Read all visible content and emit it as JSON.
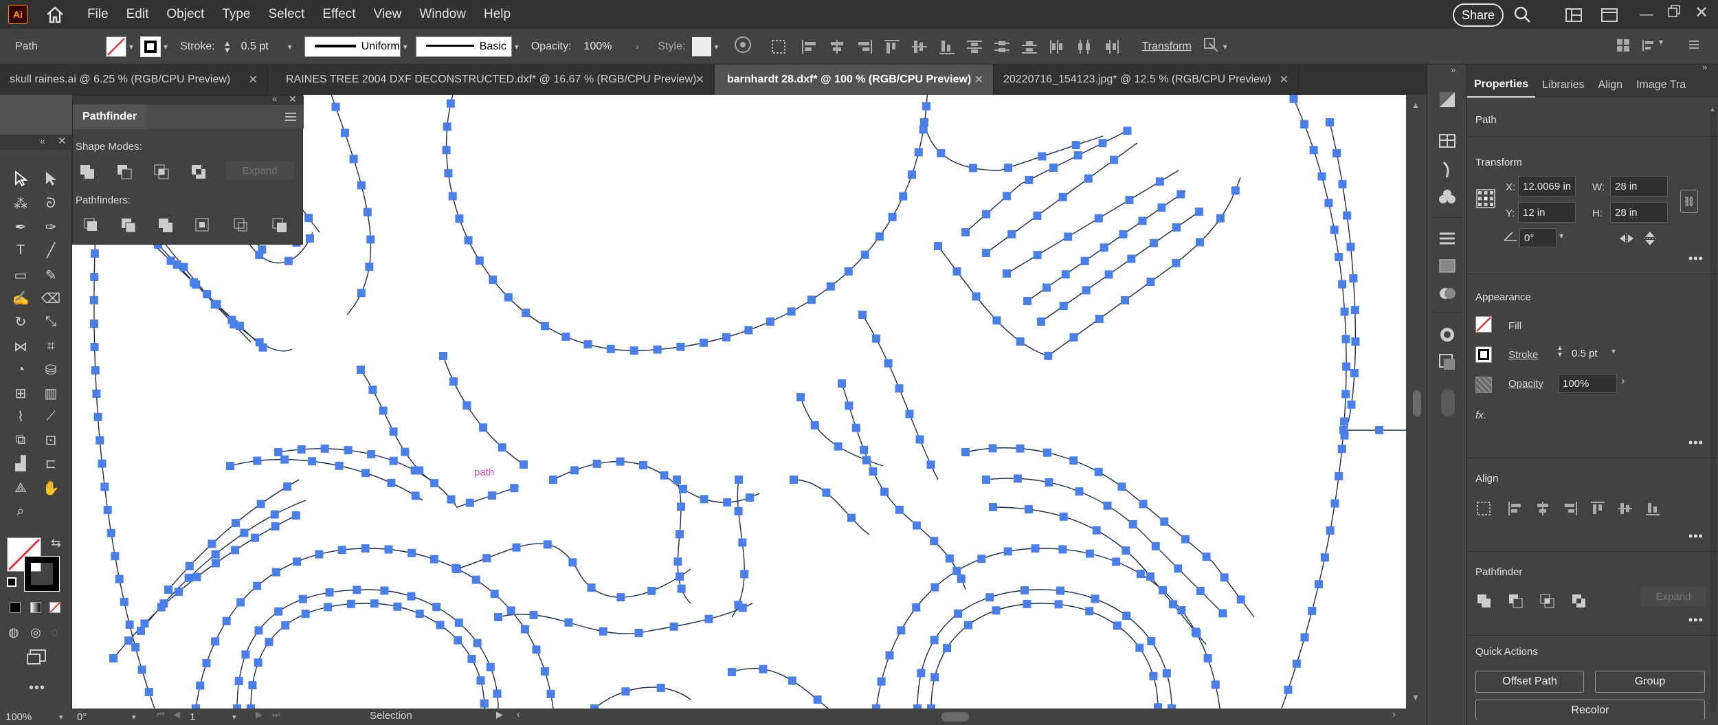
{
  "app": {
    "logo": "Ai",
    "menus": [
      "File",
      "Edit",
      "Object",
      "Type",
      "Select",
      "Effect",
      "View",
      "Window",
      "Help"
    ],
    "share_label": "Share"
  },
  "control_bar": {
    "selection_type": "Path",
    "stroke_label": "Stroke:",
    "stroke_value": "0.5 pt",
    "profile_label": "Uniform",
    "brush_label": "Basic",
    "opacity_label": "Opacity:",
    "opacity_value": "100%",
    "style_label": "Style:",
    "transform_label": "Transform"
  },
  "tabs": [
    {
      "label": "skull raines.ai @ 6.25 % (RGB/CPU Preview)",
      "active": false
    },
    {
      "label": "RAINES TREE 2004 DXF DECONSTRUCTED.dxf* @ 16.67 % (RGB/CPU Preview)",
      "active": false
    },
    {
      "label": "barnhardt 28.dxf* @ 100 % (RGB/CPU Preview)",
      "active": true
    },
    {
      "label": "20220716_154123.jpg* @ 12.5 % (RGB/CPU Preview)",
      "active": false
    }
  ],
  "canvas": {
    "hover_label": "path",
    "anchor_color": "#4a7ee8",
    "path_color": "#1a2a4a"
  },
  "pathfinder_panel": {
    "title": "Pathfinder",
    "shape_modes_label": "Shape Modes:",
    "expand_label": "Expand",
    "pathfinders_label": "Pathfinders:"
  },
  "properties_panel": {
    "tabs": [
      "Properties",
      "Libraries",
      "Align",
      "Image Tra"
    ],
    "object_type": "Path",
    "transform_title": "Transform",
    "x_label": "X:",
    "x_value": "12.0069 in",
    "y_label": "Y:",
    "y_value": "12 in",
    "w_label": "W:",
    "w_value": "28 in",
    "h_label": "H:",
    "h_value": "28 in",
    "angle_value": "0°",
    "appearance_title": "Appearance",
    "fill_label": "Fill",
    "stroke_label": "Stroke",
    "stroke_value": "0.5 pt",
    "opacity_label": "Opacity",
    "opacity_value": "100%",
    "fx_label": "fx.",
    "align_title": "Align",
    "pathfinder_title": "Pathfinder",
    "expand_label": "Expand",
    "quick_actions_title": "Quick Actions",
    "offset_path_label": "Offset Path",
    "group_label": "Group",
    "recolor_label": "Recolor"
  },
  "status_bar": {
    "zoom": "100%",
    "rotation": "0°",
    "artboard": "1",
    "tool_name": "Selection"
  },
  "colors": {
    "accent_stroke": "#e0343a",
    "anchor_blue": "#4a7ee8"
  }
}
